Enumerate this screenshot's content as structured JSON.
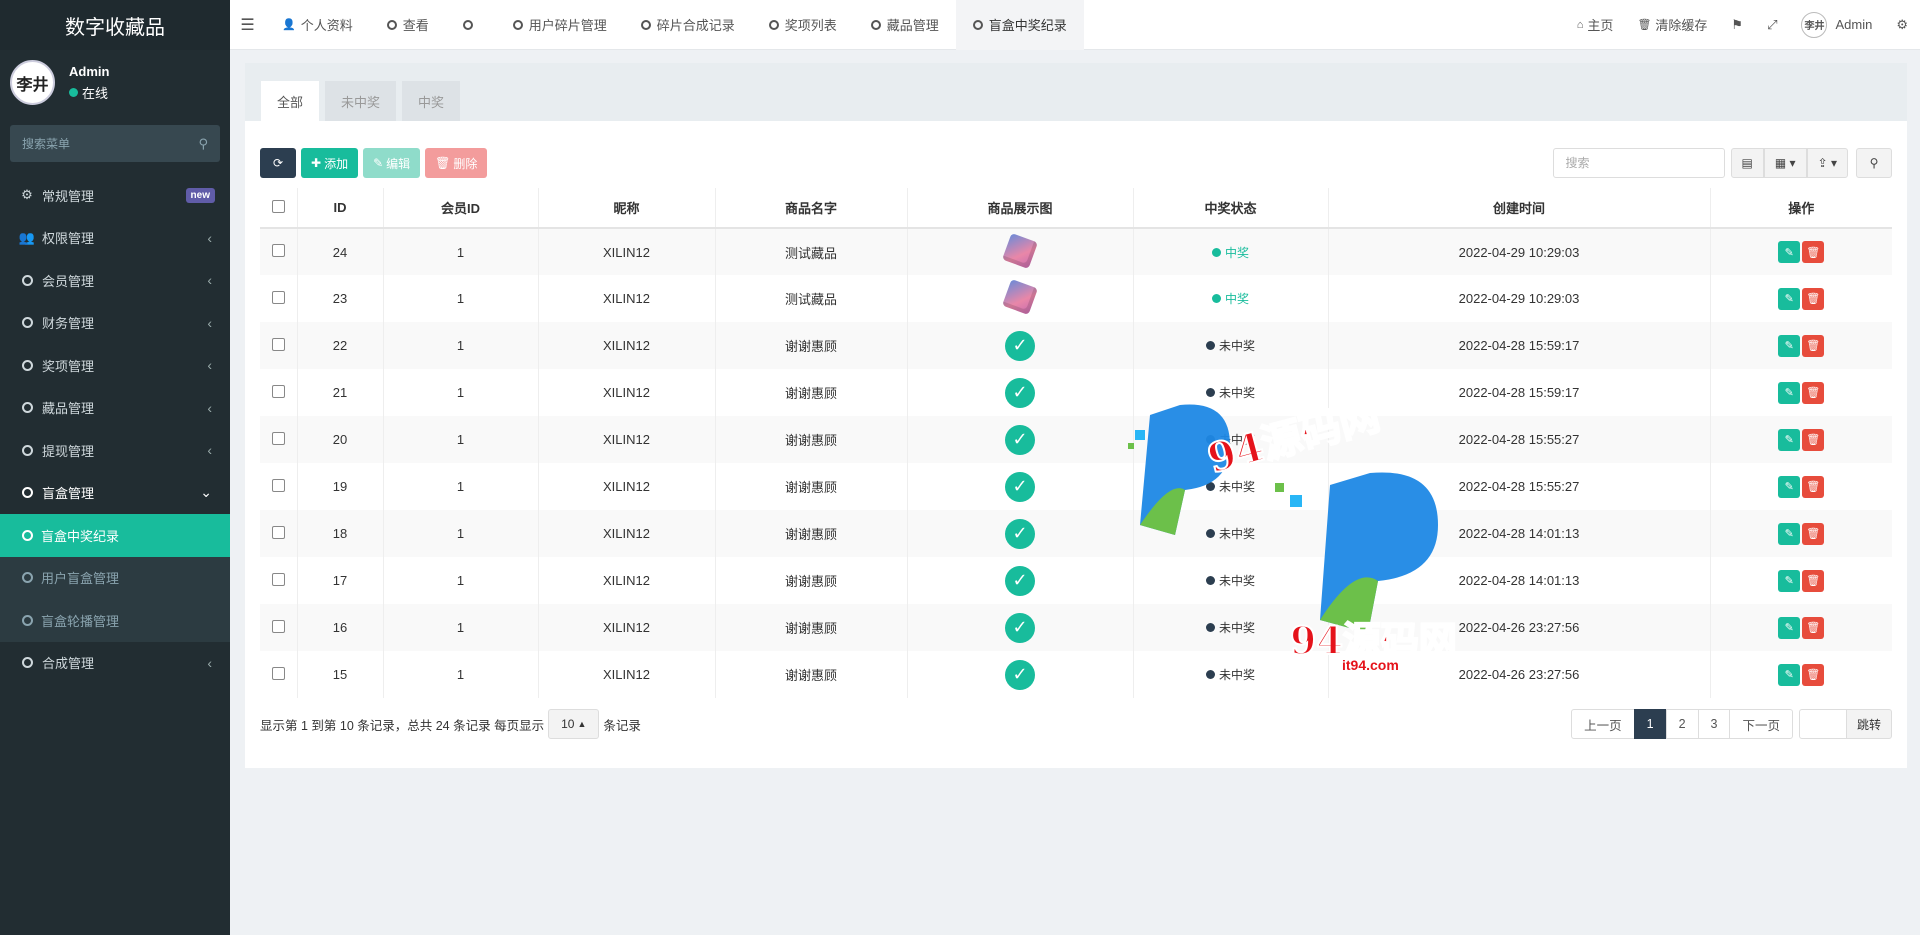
{
  "app": {
    "title": "数字收藏品"
  },
  "user": {
    "name": "Admin",
    "status": "在线",
    "avatar_text": "李井"
  },
  "sidebar": {
    "search_placeholder": "搜索菜单",
    "items": [
      {
        "label": "常规管理",
        "icon": "gears-icon",
        "badge": "new"
      },
      {
        "label": "权限管理",
        "icon": "users-icon"
      },
      {
        "label": "会员管理",
        "icon": "circle-icon"
      },
      {
        "label": "财务管理",
        "icon": "circle-icon"
      },
      {
        "label": "奖项管理",
        "icon": "circle-icon"
      },
      {
        "label": "藏品管理",
        "icon": "circle-icon"
      },
      {
        "label": "提现管理",
        "icon": "circle-icon"
      },
      {
        "label": "盲盒管理",
        "icon": "circle-icon",
        "expanded": true
      }
    ],
    "submenu": [
      {
        "label": "盲盒中奖纪录",
        "active": true
      },
      {
        "label": "用户盲盒管理"
      },
      {
        "label": "盲盒轮播管理"
      }
    ],
    "last_item": {
      "label": "合成管理",
      "icon": "circle-icon"
    }
  },
  "topbar": {
    "tabs": [
      {
        "label": "个人资料",
        "icon": "user-icon"
      },
      {
        "label": "查看",
        "icon": "circle-icon"
      },
      {
        "label": "",
        "icon": "circle-icon"
      },
      {
        "label": "用户碎片管理",
        "icon": "circle-icon"
      },
      {
        "label": "碎片合成记录",
        "icon": "circle-icon"
      },
      {
        "label": "奖项列表",
        "icon": "circle-icon"
      },
      {
        "label": "藏品管理",
        "icon": "circle-icon"
      },
      {
        "label": "盲盒中奖纪录",
        "icon": "circle-icon",
        "active": true
      }
    ],
    "home": "主页",
    "clear_cache": "清除缓存",
    "user": "Admin"
  },
  "panel": {
    "tabs": [
      "全部",
      "未中奖",
      "中奖"
    ],
    "toolbar": {
      "add": "添加",
      "edit": "编辑",
      "delete": "删除",
      "search_placeholder": "搜索"
    },
    "columns": [
      "ID",
      "会员ID",
      "昵称",
      "商品名字",
      "商品展示图",
      "中奖状态",
      "创建时间",
      "操作"
    ],
    "rows": [
      {
        "id": "24",
        "member_id": "1",
        "nickname": "XILIN12",
        "product": "测试藏品",
        "image": "gem",
        "status": "中奖",
        "win": true,
        "time": "2022-04-29 10:29:03"
      },
      {
        "id": "23",
        "member_id": "1",
        "nickname": "XILIN12",
        "product": "测试藏品",
        "image": "gem",
        "status": "中奖",
        "win": true,
        "time": "2022-04-29 10:29:03"
      },
      {
        "id": "22",
        "member_id": "1",
        "nickname": "XILIN12",
        "product": "谢谢惠顾",
        "image": "check",
        "status": "未中奖",
        "win": false,
        "time": "2022-04-28 15:59:17"
      },
      {
        "id": "21",
        "member_id": "1",
        "nickname": "XILIN12",
        "product": "谢谢惠顾",
        "image": "check",
        "status": "未中奖",
        "win": false,
        "time": "2022-04-28 15:59:17"
      },
      {
        "id": "20",
        "member_id": "1",
        "nickname": "XILIN12",
        "product": "谢谢惠顾",
        "image": "check",
        "status": "未中奖",
        "win": false,
        "time": "2022-04-28 15:55:27"
      },
      {
        "id": "19",
        "member_id": "1",
        "nickname": "XILIN12",
        "product": "谢谢惠顾",
        "image": "check",
        "status": "未中奖",
        "win": false,
        "time": "2022-04-28 15:55:27"
      },
      {
        "id": "18",
        "member_id": "1",
        "nickname": "XILIN12",
        "product": "谢谢惠顾",
        "image": "check",
        "status": "未中奖",
        "win": false,
        "time": "2022-04-28 14:01:13"
      },
      {
        "id": "17",
        "member_id": "1",
        "nickname": "XILIN12",
        "product": "谢谢惠顾",
        "image": "check",
        "status": "未中奖",
        "win": false,
        "time": "2022-04-28 14:01:13"
      },
      {
        "id": "16",
        "member_id": "1",
        "nickname": "XILIN12",
        "product": "谢谢惠顾",
        "image": "check",
        "status": "未中奖",
        "win": false,
        "time": "2022-04-26 23:27:56"
      },
      {
        "id": "15",
        "member_id": "1",
        "nickname": "XILIN12",
        "product": "谢谢惠顾",
        "image": "check",
        "status": "未中奖",
        "win": false,
        "time": "2022-04-26 23:27:56"
      }
    ],
    "footer": {
      "summary": "显示第 1 到第 10 条记录，总共 24 条记录 每页显示",
      "page_size": "10",
      "suffix": "条记录"
    },
    "pagination": {
      "prev": "上一页",
      "pages": [
        "1",
        "2",
        "3"
      ],
      "current": "1",
      "next": "下一页",
      "jump": "跳转"
    }
  },
  "watermark": {
    "text1": "94源码网",
    "text2": "94源码网",
    "text3": "it94.com",
    "brand_color": "#e5131b"
  },
  "colors": {
    "accent": "#18bc9c",
    "sidebar": "#222d32",
    "danger": "#e74c3c",
    "dark": "#2c3e50"
  }
}
